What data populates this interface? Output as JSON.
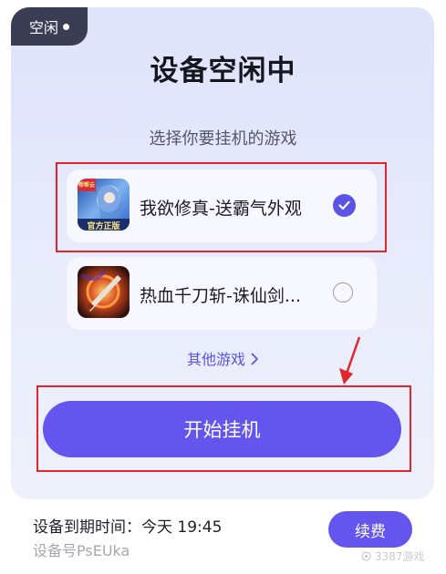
{
  "status": {
    "label": "空闲"
  },
  "header": {
    "title": "设备空闲中",
    "subtitle": "选择你要挂机的游戏"
  },
  "games": [
    {
      "name": "我欲修真-送霸气外观",
      "selected": true,
      "icon": "xianxia-game-icon",
      "icon_banner": "官方正版",
      "icon_badge": "帮帮云"
    },
    {
      "name": "热血千刀斩-诛仙剑...",
      "selected": false,
      "icon": "sword-game-icon"
    }
  ],
  "more_games": {
    "label": "其他游戏"
  },
  "actions": {
    "start_label": "开始挂机",
    "renew_label": "续费"
  },
  "device": {
    "expire_label": "设备到期时间：",
    "expire_value": "今天 19:45",
    "id_label": "设备号PsEUka"
  },
  "watermark": {
    "text": "3387游戏"
  },
  "colors": {
    "accent": "#6455ef",
    "status_bg": "#3b3d55",
    "highlight": "#e0262b"
  }
}
